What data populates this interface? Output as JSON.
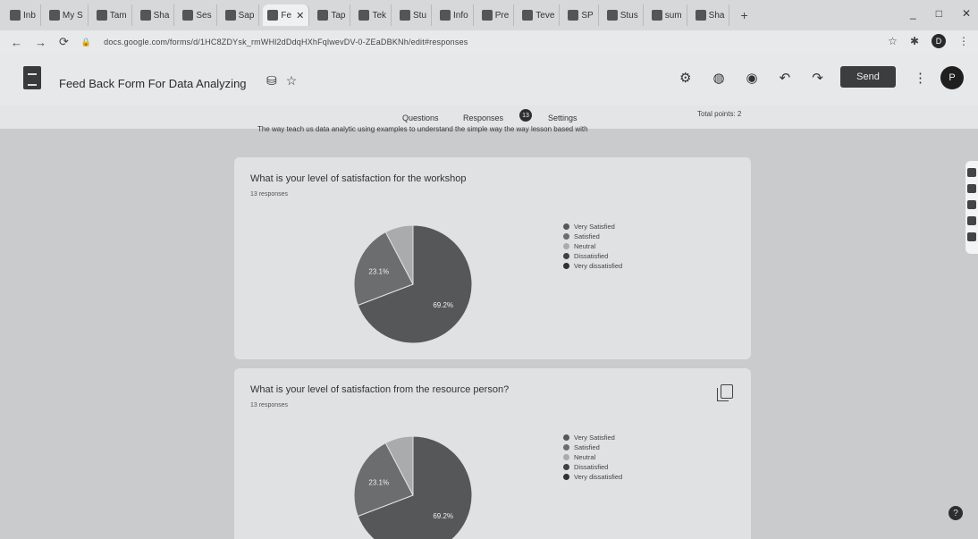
{
  "browser": {
    "tabs": [
      {
        "label": "Inb",
        "icon": "gmail-icon"
      },
      {
        "label": "My S",
        "icon": "drive-icon"
      },
      {
        "label": "Tam",
        "icon": "classroom-icon"
      },
      {
        "label": "Sha",
        "icon": "drive-icon"
      },
      {
        "label": "Ses",
        "icon": "forms-icon"
      },
      {
        "label": "Sap",
        "icon": "forms-icon"
      },
      {
        "label": "Fe",
        "icon": "forms-icon",
        "active": true
      },
      {
        "label": "Tap",
        "icon": "classroom-icon"
      },
      {
        "label": "Tek",
        "icon": "classroom-icon"
      },
      {
        "label": "Stu",
        "icon": "classroom-icon"
      },
      {
        "label": "Info",
        "icon": "forms-icon"
      },
      {
        "label": "Pre",
        "icon": "forms-icon"
      },
      {
        "label": "Teve",
        "icon": "forms-icon"
      },
      {
        "label": "SP",
        "icon": "classroom-icon"
      },
      {
        "label": "Stus",
        "icon": "classroom-icon"
      },
      {
        "label": "sum",
        "icon": "image-icon"
      },
      {
        "label": "Sha",
        "icon": "web-icon"
      }
    ],
    "url": "docs.google.com/forms/d/1HC8ZDYsk_rmWHl2dDdqHXhFqlwevDV-0-ZEaDBKNh/edit#responses",
    "window_controls": [
      "_",
      "□",
      "✕"
    ],
    "profile_initial": "D"
  },
  "form": {
    "title": "Feed Back Form For Data Analyzing",
    "send_label": "Send",
    "avatar_initial": "P",
    "tabs": {
      "questions": "Questions",
      "responses": "Responses",
      "settings": "Settings"
    },
    "response_count": "13",
    "total_points": "Total points: 2",
    "description": "The way teach us data analytic using examples to understand the simple way the way lesson based with"
  },
  "questions": [
    {
      "title": "What is your level of satisfaction for the workshop",
      "subtitle": "13 responses",
      "chart_data": {
        "type": "pie",
        "categories": [
          "Very Satisfied",
          "Satisfied",
          "Neutral",
          "Dissatisfied",
          "Very dissatisfied"
        ],
        "values": [
          69.2,
          23.1,
          7.7,
          0,
          0
        ],
        "labels_shown": [
          "23.1%",
          "69.2%"
        ],
        "colors": [
          "#555759",
          "#6b6d6f",
          "#a9abad",
          "#3f4143",
          "#2f3133"
        ]
      }
    },
    {
      "title": "What is your level of satisfaction from the resource person?",
      "subtitle": "13 responses",
      "chart_data": {
        "type": "pie",
        "categories": [
          "Very Satisfied",
          "Satisfied",
          "Neutral",
          "Dissatisfied",
          "Very dissatisfied"
        ],
        "values": [
          69.2,
          23.1,
          7.7,
          0,
          0
        ],
        "labels_shown": [
          "23.1%",
          "69.2%"
        ],
        "colors": [
          "#555759",
          "#6b6d6f",
          "#a9abad",
          "#3f4143",
          "#2f3133"
        ]
      }
    }
  ]
}
